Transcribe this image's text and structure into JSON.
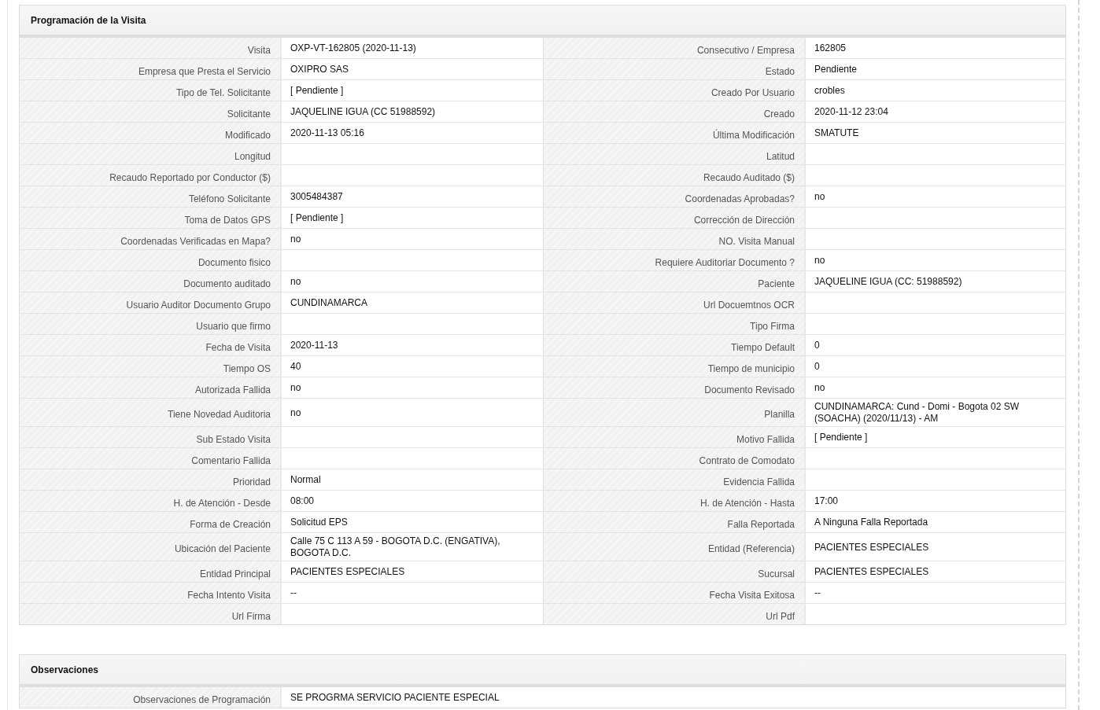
{
  "sections": [
    {
      "title": "Programación de la Visita",
      "rows": [
        {
          "left": {
            "label": "Visita",
            "value": "OXP-VT-162805 (2020-11-13)"
          },
          "right": {
            "label": "Consecutivo / Empresa",
            "value": "162805"
          }
        },
        {
          "left": {
            "label": "Empresa que Presta el Servicio",
            "value": "OXIPRO SAS"
          },
          "right": {
            "label": "Estado",
            "value": "Pendiente"
          }
        },
        {
          "left": {
            "label": "Tipo de Tel. Solicitante",
            "value": "[ Pendiente ]"
          },
          "right": {
            "label": "Creado Por Usuario",
            "value": "crobles"
          }
        },
        {
          "left": {
            "label": "Solicitante",
            "value": "JAQUELINE IGUA (CC 51988592)"
          },
          "right": {
            "label": "Creado",
            "value": "2020-11-12 23:04"
          }
        },
        {
          "left": {
            "label": "Modificado",
            "value": "2020-11-13 05:16"
          },
          "right": {
            "label": "Última Modificación",
            "value": "SMATUTE"
          }
        },
        {
          "left": {
            "label": "Longitud"
          },
          "right": {
            "label": "Latitud"
          }
        },
        {
          "left": {
            "label": "Recaudo Reportado por Conductor ($)"
          },
          "right": {
            "label": "Recaudo Auditado ($)"
          }
        },
        {
          "left": {
            "label": "Teléfono Solicitante",
            "value": "3005484387"
          },
          "right": {
            "label": "Coordenadas Aprobadas?",
            "value": "no"
          }
        },
        {
          "left": {
            "label": "Toma de Datos GPS",
            "value": "[ Pendiente ]"
          },
          "right": {
            "label": "Corrección de Dirección"
          }
        },
        {
          "left": {
            "label": "Coordenadas Verificadas en Mapa?",
            "value": "no"
          },
          "right": {
            "label": "NO. Visita Manual"
          }
        },
        {
          "left": {
            "label": "Documento fisico"
          },
          "right": {
            "label": "Requiere Auditoriar Documento ?",
            "value": "no"
          }
        },
        {
          "left": {
            "label": "Documento auditado",
            "value": "no"
          },
          "right": {
            "label": "Paciente",
            "value": "JAQUELINE IGUA (CC: 51988592)"
          }
        },
        {
          "left": {
            "label": "Usuario Auditor Documento Grupo",
            "value": "CUNDINAMARCA"
          },
          "right": {
            "label": "Url Docuemtnos OCR"
          }
        },
        {
          "left": {
            "label": "Usuario que firmo"
          },
          "right": {
            "label": "Tipo Firma"
          }
        },
        {
          "left": {
            "label": "Fecha de Visita",
            "value": "2020-11-13"
          },
          "right": {
            "label": "Tiempo Default",
            "value": "0"
          }
        },
        {
          "left": {
            "label": "Tiempo OS",
            "value": "40"
          },
          "right": {
            "label": "Tiempo de municipio",
            "value": "0"
          }
        },
        {
          "left": {
            "label": "Autorizada Fallida",
            "value": "no"
          },
          "right": {
            "label": "Documento Revisado",
            "value": "no"
          }
        },
        {
          "left": {
            "label": "Tiene Novedad Auditoria",
            "value": "no"
          },
          "right": {
            "label": "Planilla",
            "value": "CUNDINAMARCA: Cund - Domi - Bogota 02 SW (SOACHA) (2020/11/13) - AM"
          }
        },
        {
          "left": {
            "label": "Sub Estado Visita"
          },
          "right": {
            "label": "Motivo Fallida",
            "value": "[ Pendiente ]"
          }
        },
        {
          "left": {
            "label": "Comentario Fallida"
          },
          "right": {
            "label": "Contrato de Comodato"
          }
        },
        {
          "left": {
            "label": "Prioridad",
            "value": "Normal"
          },
          "right": {
            "label": "Evidencia Fallida"
          }
        },
        {
          "left": {
            "label": "H. de Atención - Desde",
            "value": "08:00"
          },
          "right": {
            "label": "H. de Atención - Hasta",
            "value": "17:00"
          }
        },
        {
          "left": {
            "label": "Forma de Creación",
            "value": "Solicitud EPS"
          },
          "right": {
            "label": "Falla Reportada",
            "value": "A Ninguna Falla Reportada"
          }
        },
        {
          "left": {
            "label": "Ubicación del Paciente",
            "value": "Calle 75 C 113 A 59 - BOGOTA D.C. (ENGATIVA), BOGOTA D.C."
          },
          "right": {
            "label": "Entidad (Referencia)",
            "value": "PACIENTES ESPECIALES"
          }
        },
        {
          "left": {
            "label": "Entidad Principal",
            "value": "PACIENTES ESPECIALES"
          },
          "right": {
            "label": "Sucursal",
            "value": "PACIENTES ESPECIALES"
          }
        },
        {
          "left": {
            "label": "Fecha Intento Visita",
            "value": "--"
          },
          "right": {
            "label": "Fecha Visita Exitosa",
            "value": "--"
          }
        },
        {
          "left": {
            "label": "Url Firma"
          },
          "right": {
            "label": "Url Pdf"
          }
        }
      ]
    },
    {
      "title": "Observaciones",
      "rows": [
        {
          "left": {
            "label": "Observaciones de Programación",
            "value": "SE PROGRMA SERVICIO PACIENTE ESPECIAL"
          }
        }
      ]
    }
  ]
}
